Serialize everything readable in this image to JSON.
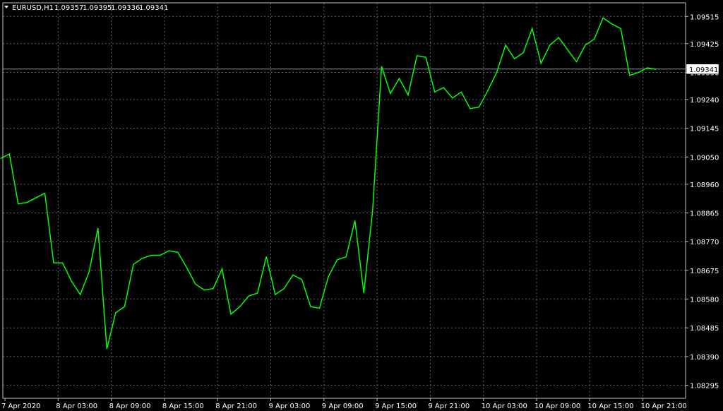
{
  "header": {
    "symbol": "EURUSD,H1",
    "open": "1.09357",
    "high": "1.09395",
    "low": "1.09336",
    "close": "1.09341"
  },
  "colors": {
    "background": "#000000",
    "line": "#00ff00",
    "grid": "#5a6570",
    "frame": "#c0c0c0",
    "text": "#ffffff",
    "bid_line": "#8a93a6"
  },
  "chart_data": {
    "type": "line",
    "title": "EURUSD,H1",
    "grid": true,
    "ylim": [
      1.08252,
      1.0956
    ],
    "current_price": 1.09341,
    "current_price_label": "1.09341",
    "y_ticks": [
      "1.09515",
      "1.09425",
      "1.09330",
      "1.09240",
      "1.09145",
      "1.09050",
      "1.08960",
      "1.08865",
      "1.08770",
      "1.08675",
      "1.08580",
      "1.08485",
      "1.08390",
      "1.08295"
    ],
    "x_tick_labels": [
      "7 Apr 2020",
      "8 Apr 03:00",
      "8 Apr 09:00",
      "8 Apr 15:00",
      "8 Apr 21:00",
      "9 Apr 03:00",
      "9 Apr 09:00",
      "9 Apr 15:00",
      "9 Apr 21:00",
      "10 Apr 03:00",
      "10 Apr 09:00",
      "10 Apr 15:00",
      "10 Apr 21:00"
    ],
    "x_start": "7 Apr 2020 21:00",
    "x": [
      -0.5,
      0.5,
      1.5,
      2.5,
      3.5,
      4.5,
      5.5,
      6.5,
      7.5,
      8.5,
      9.5,
      10.5,
      11.5,
      12.5,
      13.5,
      14.5,
      15.5,
      16.5,
      17.5,
      18.5,
      19.5,
      20.5,
      21.5,
      22.5,
      23.5,
      24.5,
      25.5,
      26.5,
      27.5,
      28.5,
      29.5,
      30.5,
      31.5,
      32.5,
      33.5,
      34.5,
      35.5,
      36.5,
      37.5,
      38.5,
      39.5,
      40.5,
      41.5,
      42.5,
      43.5,
      44.5,
      45.5,
      46.5,
      47.5,
      48.5,
      49.5,
      50.5,
      51.5,
      52.5,
      53.5,
      54.5,
      55.5,
      56.5,
      57.5,
      58.5,
      59.5,
      60.5,
      61.5,
      62.5,
      63.5,
      64.5,
      65.5,
      66.5,
      67.5,
      68.5,
      69.5,
      70.5,
      71.5,
      72.5,
      73.5
    ],
    "values": [
      1.09045,
      1.0906,
      1.08895,
      1.089,
      1.08915,
      1.0893,
      1.087,
      1.087,
      1.0864,
      1.08595,
      1.0867,
      1.08815,
      1.08415,
      1.08535,
      1.08555,
      1.08695,
      1.08715,
      1.08725,
      1.08725,
      1.0874,
      1.08735,
      1.08685,
      1.0863,
      1.0861,
      1.08615,
      1.0868,
      1.0853,
      1.08555,
      1.0859,
      1.086,
      1.0872,
      1.08595,
      1.08615,
      1.0866,
      1.08645,
      1.08555,
      1.0855,
      1.08655,
      1.0871,
      1.0872,
      1.0884,
      1.086,
      1.08875,
      1.0935,
      1.0926,
      1.0931,
      1.09255,
      1.09385,
      1.0938,
      1.09265,
      1.0928,
      1.09245,
      1.09265,
      1.0921,
      1.09215,
      1.0927,
      1.0933,
      1.0942,
      1.09375,
      1.09395,
      1.09475,
      1.0936,
      1.0942,
      1.09445,
      1.09405,
      1.09365,
      1.0942,
      1.0944,
      1.0951,
      1.0949,
      1.09475,
      1.0932,
      1.0933,
      1.09345,
      1.0934
    ]
  }
}
